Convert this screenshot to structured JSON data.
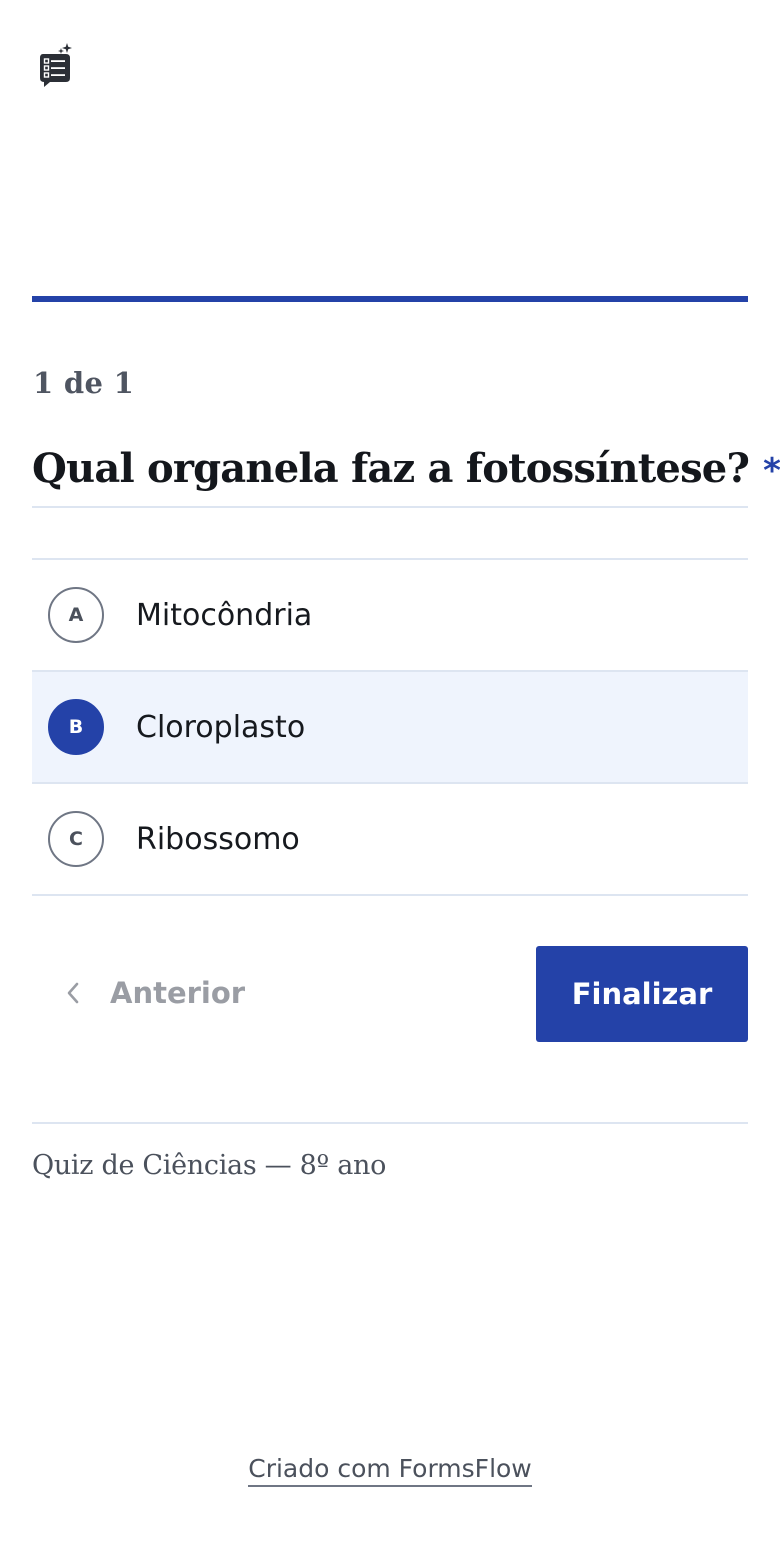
{
  "brand": {
    "icon": "form-sparkle-icon"
  },
  "progress": {
    "fraction": 1.0,
    "color": "#2442a8",
    "counter": "1 de 1"
  },
  "question": {
    "text": "Qual organela faz a fotossíntese?",
    "required_mark": "*"
  },
  "options": [
    {
      "letter": "A",
      "label": "Mitocôndria",
      "selected": false
    },
    {
      "letter": "B",
      "label": "Cloroplasto",
      "selected": true
    },
    {
      "letter": "C",
      "label": "Ribossomo",
      "selected": false
    }
  ],
  "navigation": {
    "prev_label": "Anterior",
    "prev_icon": "chevron-left-icon",
    "finish_label": "Finalizar"
  },
  "footer": {
    "quiz_title": "Quiz de Ciências — 8º ano",
    "created_with": "Criado com FormsFlow"
  },
  "colors": {
    "accent": "#2442a8",
    "selected_background": "#eff4fd",
    "divider": "#dde5f1"
  }
}
